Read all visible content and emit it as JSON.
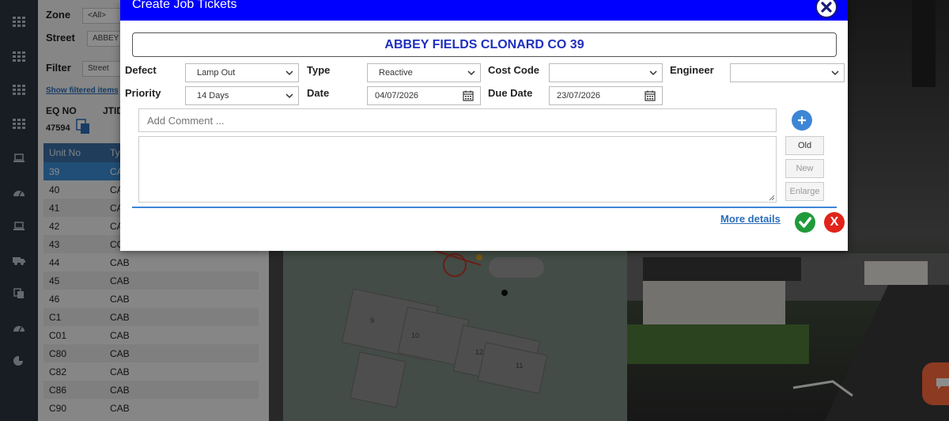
{
  "background": {
    "filters": {
      "zone_label": "Zone",
      "zone_value": "<All>",
      "street_label": "Street",
      "street_value": "ABBEY I",
      "filter_label": "Filter",
      "filter_value": "Street",
      "show_filtered": "Show filtered items",
      "eqno_label": "EQ NO",
      "jtid_label": "JTID",
      "eqno_value": "47594"
    },
    "unit_table": {
      "headers": [
        "Unit No",
        "Ty"
      ],
      "rows": [
        [
          "39",
          "CA"
        ],
        [
          "40",
          "CA"
        ],
        [
          "41",
          "CA"
        ],
        [
          "42",
          "CA"
        ],
        [
          "43",
          "CO"
        ],
        [
          "44",
          "CAB"
        ],
        [
          "45",
          "CAB"
        ],
        [
          "46",
          "CAB"
        ],
        [
          "C1",
          "CAB"
        ],
        [
          "C01",
          "CAB"
        ],
        [
          "C80",
          "CAB"
        ],
        [
          "C82",
          "CAB"
        ],
        [
          "C86",
          "CAB"
        ],
        [
          "C90",
          "CAB"
        ]
      ],
      "selected_row": 0
    },
    "map_numbers": [
      "9",
      "10",
      "12",
      "11"
    ]
  },
  "modal": {
    "title": "Create Job Tickets",
    "site_title": "ABBEY FIELDS CLONARD CO 39",
    "defect_label": "Defect",
    "defect_value": "Lamp Out",
    "type_label": "Type",
    "type_value": "Reactive",
    "cost_code_label": "Cost Code",
    "cost_code_value": "",
    "engineer_label": "Engineer",
    "engineer_value": "",
    "priority_label": "Priority",
    "priority_value": "14 Days",
    "date_label": "Date",
    "date_value": "04/07/2026",
    "due_date_label": "Due Date",
    "due_date_value": "23/07/2026",
    "comment_placeholder": "Add Comment ...",
    "old_label": "Old",
    "new_label": "New",
    "enlarge_label": "Enlarge",
    "more_details": "More details",
    "cancel_label": "X"
  },
  "colors": {
    "header_blue": "#0000ff",
    "title_blue": "#1f2fbf",
    "confirm_green": "#1f9a3a",
    "cancel_red": "#e2231a",
    "accent": "#3d86d6"
  }
}
